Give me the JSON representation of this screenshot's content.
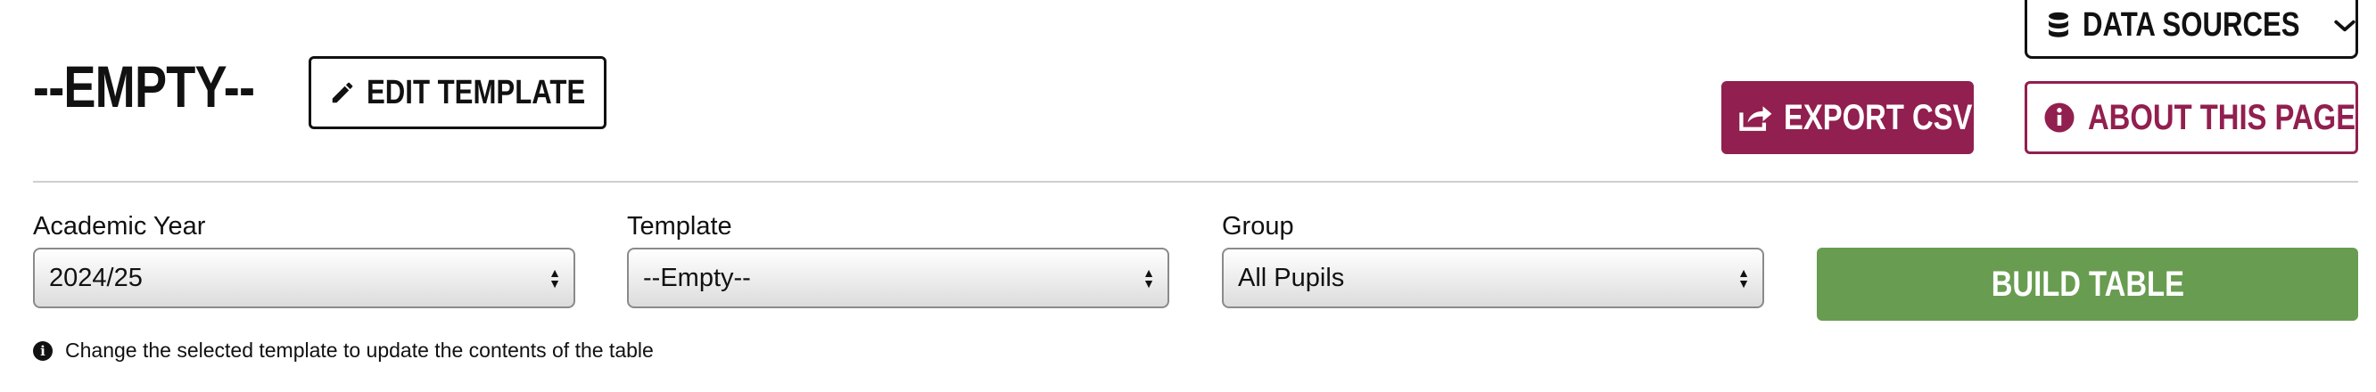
{
  "header": {
    "title": "--EMPTY--",
    "edit_template_label": "EDIT TEMPLATE",
    "data_sources_label": "DATA SOURCES",
    "export_csv_label": "EXPORT CSV",
    "about_page_label": "ABOUT THIS PAGE"
  },
  "filters": {
    "academic_year": {
      "label": "Academic Year",
      "value": "2024/25"
    },
    "template": {
      "label": "Template",
      "value": "--Empty--"
    },
    "group": {
      "label": "Group",
      "value": "All Pupils"
    }
  },
  "build_table_label": "BUILD TABLE",
  "info_text": "Change the selected template to update the contents of the table",
  "colors": {
    "brand": "#911f4f",
    "build": "#689c50",
    "text": "#111111"
  },
  "icons": {
    "edit": "pencil-icon",
    "data_sources": "database-icon",
    "dropdown": "chevron-down-icon",
    "export": "share-icon",
    "about": "info-circle-icon",
    "select": "select-arrows-icon"
  }
}
